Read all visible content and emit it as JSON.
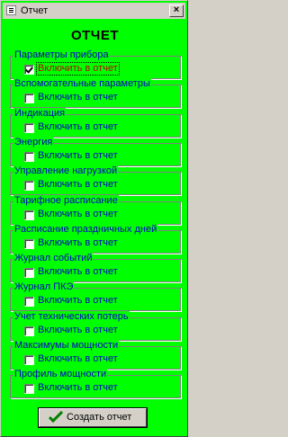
{
  "window": {
    "title": "Отчет",
    "close_glyph": "×"
  },
  "heading": "ОТЧЕТ",
  "colors": {
    "background": "#00ff00",
    "label": "#0000c8",
    "focused_label": "#c00000"
  },
  "groups": [
    {
      "title": "Параметры прибора",
      "checkbox_label": "Включить в отчет",
      "checked": true,
      "focused": true
    },
    {
      "title": "Вспомогательные параметры",
      "checkbox_label": "Включить в отчет",
      "checked": false
    },
    {
      "title": "Индикация",
      "checkbox_label": "Включить в отчет",
      "checked": false
    },
    {
      "title": "Энергия",
      "checkbox_label": "Включить в отчет",
      "checked": false
    },
    {
      "title": "Управление нагрузкой",
      "checkbox_label": "Включить в отчет",
      "checked": false
    },
    {
      "title": "Тарифное расписание",
      "checkbox_label": "Включить в отчет",
      "checked": false
    },
    {
      "title": "Расписание праздничных дней",
      "checkbox_label": "Включить в отчет",
      "checked": false
    },
    {
      "title": "Журнал событий",
      "checkbox_label": "Включить в отчет",
      "checked": false
    },
    {
      "title": "Журнал ПКЭ",
      "checkbox_label": "Включить в отчет",
      "checked": false
    },
    {
      "title": "Учет технических потерь",
      "checkbox_label": "Включить в отчет",
      "checked": false
    },
    {
      "title": "Максимумы мощности",
      "checkbox_label": "Включить в отчет",
      "checked": false
    },
    {
      "title": "Профиль мощности",
      "checkbox_label": "Включить в отчет",
      "checked": false
    }
  ],
  "create_button": {
    "label": "Создать отчет",
    "icon": "check-icon"
  }
}
